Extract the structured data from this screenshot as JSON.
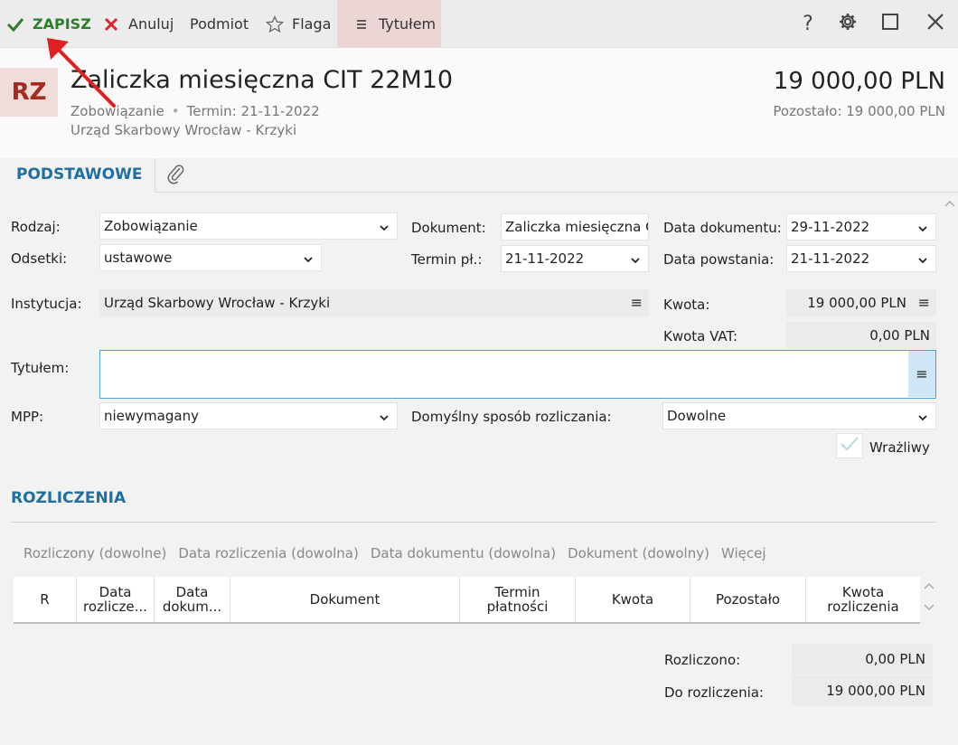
{
  "toolbar": {
    "save": "ZAPISZ",
    "cancel": "Anuluj",
    "subject": "Podmiot",
    "flag": "Flaga",
    "title": "Tytułem",
    "help": "?"
  },
  "header": {
    "badge": "RZ",
    "title": "Zaliczka miesięczna CIT 22M10",
    "type": "Zobowiązanie",
    "deadline": "Termin: 21-11-2022",
    "institution": "Urząd Skarbowy Wrocław - Krzyki",
    "amount": "19 000,00 PLN",
    "remaining": "Pozostało: 19 000,00 PLN"
  },
  "tabs": {
    "basic": "PODSTAWOWE"
  },
  "form": {
    "rodzaj_label": "Rodzaj:",
    "rodzaj_value": "Zobowiązanie",
    "odsetki_label": "Odsetki:",
    "odsetki_value": "ustawowe",
    "dokument_label": "Dokument:",
    "dokument_value": "Zaliczka miesięczna C",
    "termin_label": "Termin pł.:",
    "termin_value": "21-11-2022",
    "data_dok_label": "Data dokumentu:",
    "data_dok_value": "29-11-2022",
    "data_pow_label": "Data powstania:",
    "data_pow_value": "21-11-2022",
    "instytucja_label": "Instytucja:",
    "instytucja_value": "Urząd Skarbowy Wrocław - Krzyki",
    "kwota_label": "Kwota:",
    "kwota_value": "19 000,00 PLN",
    "kwota_vat_label": "Kwota VAT:",
    "kwota_vat_value": "0,00 PLN",
    "tytulem_label": "Tytułem:",
    "tytulem_value": "",
    "mpp_label": "MPP:",
    "mpp_value": "niewymagany",
    "sposob_label": "Domyślny sposób rozliczania:",
    "sposob_value": "Dowolne",
    "wrazliwy_label": "Wrażliwy"
  },
  "settlements": {
    "title": "ROZLICZENIA",
    "filters": [
      "Rozliczony (dowolne)",
      "Data rozliczenia (dowolna)",
      "Data dokumentu (dowolna)",
      "Dokument (dowolny)",
      "Więcej"
    ],
    "columns": [
      "R",
      "Data rozlicze...",
      "Data dokum...",
      "Dokument",
      "Termin płatności",
      "Kwota",
      "Pozostało",
      "Kwota rozliczenia"
    ],
    "rozliczono_label": "Rozliczono:",
    "rozliczono_value": "0,00 PLN",
    "do_rozliczenia_label": "Do rozliczenia:",
    "do_rozliczenia_value": "19 000,00 PLN"
  },
  "colors": {
    "accent": "#1f6fa3",
    "save_green": "#2d7d2d",
    "cancel_red": "#d9262c",
    "badge_bg": "#f0dcd8",
    "badge_text": "#a52a1f",
    "title_btn_bg": "#ecd6d5",
    "annotation_arrow": "#e02020"
  },
  "icons": {
    "save": "check-icon",
    "cancel": "x-icon",
    "flag": "star-outline-icon",
    "title": "menu-lines-icon",
    "help": "question-icon",
    "settings": "gear-icon",
    "maximize": "square-icon",
    "close": "close-icon",
    "attachment": "paperclip-icon"
  }
}
